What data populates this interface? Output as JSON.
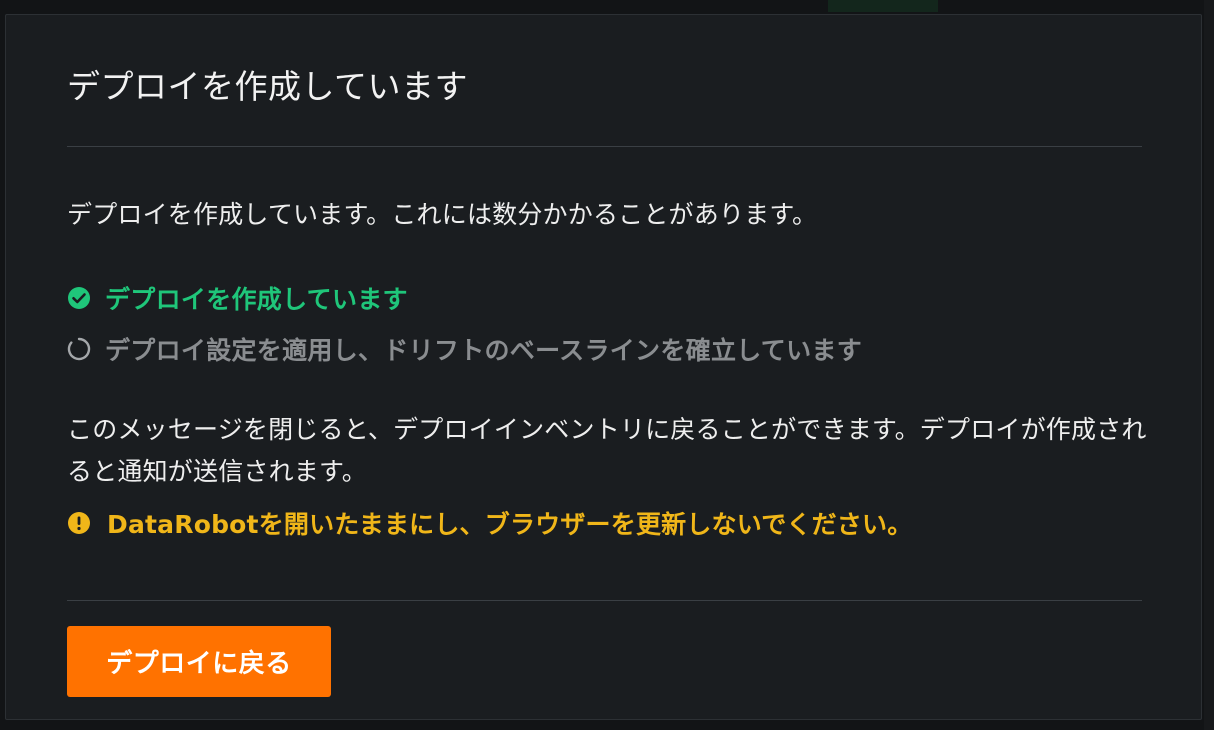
{
  "colors": {
    "success": "#1fc67a",
    "pending": "#8a8d90",
    "warning": "#f0b619",
    "primary_button": "#ff7200",
    "modal_background": "#1a1d20"
  },
  "modal": {
    "title": "デプロイを作成しています",
    "intro": "デプロイを作成しています。これには数分かかることがあります。",
    "steps": [
      {
        "label": "デプロイを作成しています",
        "status": "complete",
        "icon": "check-circle-icon"
      },
      {
        "label": "デプロイ設定を適用し、ドリフトのベースラインを確立しています",
        "status": "in-progress",
        "icon": "spinner-icon"
      }
    ],
    "info": "このメッセージを閉じると、デプロイインベントリに戻ることができます。デプロイが作成されると通知が送信されます。",
    "warning": {
      "icon": "exclamation-circle-icon",
      "text": "DataRobotを開いたままにし、ブラウザーを更新しないでください。"
    },
    "button_label": "デプロイに戻る"
  }
}
